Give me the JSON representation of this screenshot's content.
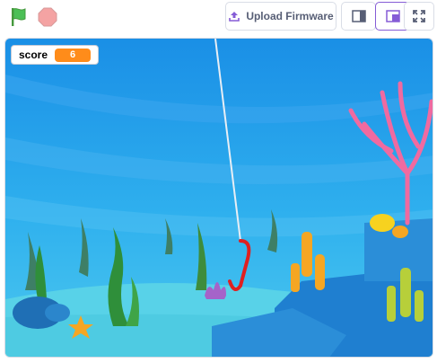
{
  "toolbar": {
    "upload_label": "Upload Firmware",
    "green_flag": "green-flag-icon",
    "stop": "stop-icon",
    "small_stage": "small-stage-icon",
    "large_stage": "large-stage-icon",
    "fullscreen": "fullscreen-icon"
  },
  "monitor": {
    "label": "score",
    "value": "6"
  },
  "colors": {
    "accent": "#855cd6",
    "flag_green": "#4cbf56",
    "stop_red": "#ec5959",
    "monitor_orange": "#ff8c1a"
  }
}
